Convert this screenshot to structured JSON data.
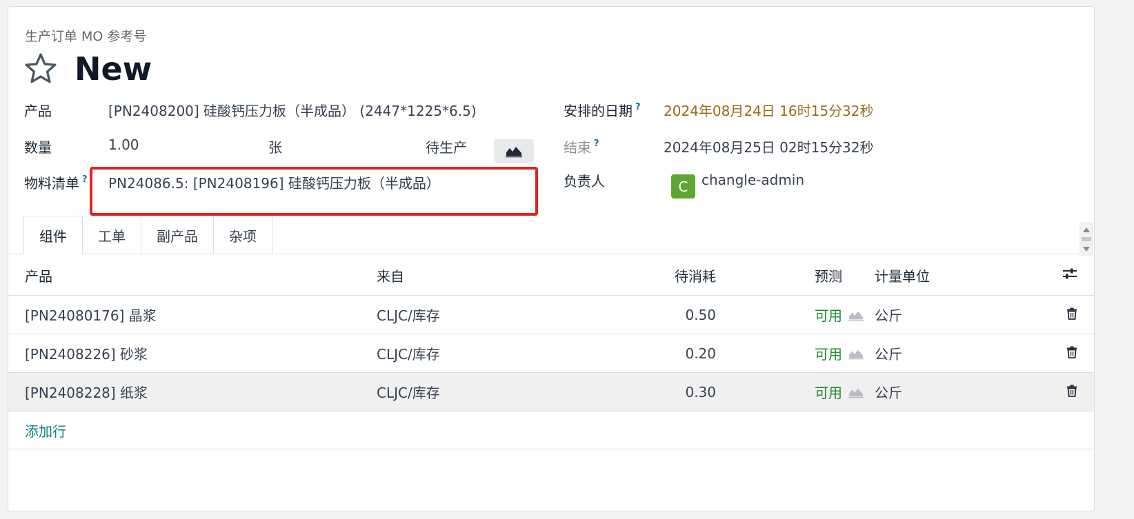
{
  "header": {
    "ref_label": "生产订单 MO 参考号",
    "title": "New"
  },
  "form": {
    "product_label": "产品",
    "product_value": "[PN2408200] 硅酸钙压力板（半成品） (2447*1225*6.5)",
    "qty_label": "数量",
    "qty_value": "1.00",
    "uom_value": "张",
    "status_value": "待生产",
    "bom_label": "物料清单",
    "bom_help": "?",
    "bom_value": "PN24086.5: [PN2408196] 硅酸钙压力板（半成品）",
    "scheduled_label": "安排的日期",
    "scheduled_help": "?",
    "scheduled_value": "2024年08月24日 16时15分32秒",
    "end_label": "结束",
    "end_help": "?",
    "end_value": "2024年08月25日 02时15分32秒",
    "responsible_label": "负责人",
    "responsible_avatar": "C",
    "responsible_value": "changle-admin"
  },
  "tabs": [
    {
      "label": "组件"
    },
    {
      "label": "工单"
    },
    {
      "label": "副产品"
    },
    {
      "label": "杂项"
    }
  ],
  "table": {
    "headers": {
      "product": "产品",
      "from": "来自",
      "to_consume": "待消耗",
      "forecast": "预测",
      "uom": "计量单位"
    },
    "rows": [
      {
        "product": "[PN24080176] 晶浆",
        "from": "CLJC/库存",
        "qty": "0.50",
        "forecast": "可用",
        "uom": "公斤"
      },
      {
        "product": "[PN2408226] 砂浆",
        "from": "CLJC/库存",
        "qty": "0.20",
        "forecast": "可用",
        "uom": "公斤"
      },
      {
        "product": "[PN2408228] 纸浆",
        "from": "CLJC/库存",
        "qty": "0.30",
        "forecast": "可用",
        "uom": "公斤"
      }
    ],
    "add_line": "添加行"
  },
  "colors": {
    "accent": "#0f7f84",
    "available": "#1c8a2a",
    "scheduled_date": "#9a6b16",
    "highlight": "#e81f1f",
    "avatar": "#5fa534"
  }
}
